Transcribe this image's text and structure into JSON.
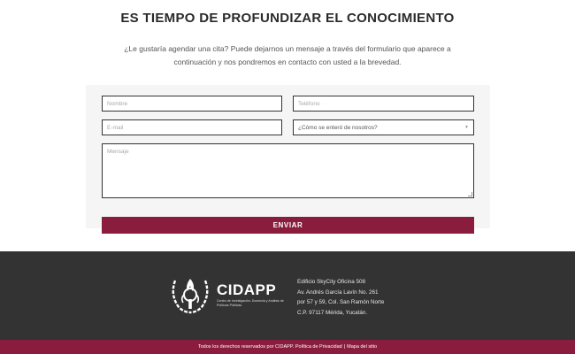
{
  "heading": "ES TIEMPO DE PROFUNDIZAR EL CONOCIMIENTO",
  "intro_line1": "¿Le gustaría agendar una cita? Puede dejarnos un mensaje a través del formulario que aparece a",
  "intro_line2": "continuación y nos pondremos en contacto con usted a la brevedad.",
  "form": {
    "name_placeholder": "Nombre",
    "phone_placeholder": "Teléfono",
    "email_placeholder": "E-mail",
    "source_select_value": "¿Cómo se enteró de nosotros?",
    "message_placeholder": "Mensaje",
    "submit_label": "ENVIAR"
  },
  "footer": {
    "logo_text": "CIDAPP",
    "logo_subtitle": "Centro de Investigación, Docencia y Análisis de Políticas Públicas",
    "address": [
      "Edificio SkyCity Oficina 508",
      "Av. Andrés García Lavín No. 261",
      "por 57 y 59, Col. San Ramón Norte",
      "C.P. 97117 Mérida, Yucatán."
    ],
    "copyright": "Todos los derechos reservados por CIDAPP.",
    "privacy_link": "Política de Privacidad",
    "separator": "|",
    "sitemap_link": "Mapa del sitio"
  },
  "colors": {
    "accent": "#8a1c3e",
    "footer_bg": "#333333",
    "form_bg": "#f5f5f5"
  }
}
